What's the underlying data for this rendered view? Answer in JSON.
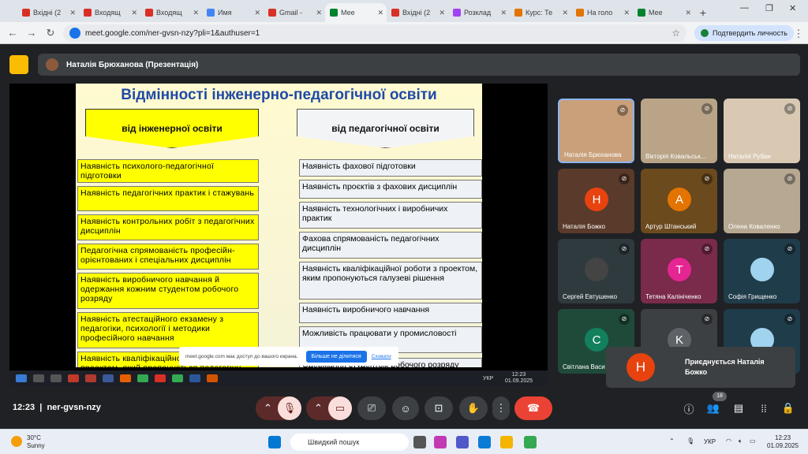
{
  "browser": {
    "tabs": [
      {
        "label": "Вхідні (2",
        "color": "#d93025"
      },
      {
        "label": "Входящ",
        "color": "#d93025"
      },
      {
        "label": "Входящ",
        "color": "#d93025"
      },
      {
        "label": "Имя",
        "color": "#4285f4"
      },
      {
        "label": "Gmail -",
        "color": "#d93025"
      },
      {
        "label": "Мее",
        "color": "#00832d",
        "active": true
      },
      {
        "label": "Вхідні (2",
        "color": "#d93025"
      },
      {
        "label": "Розклад",
        "color": "#a142f4"
      },
      {
        "label": "Курс: Те",
        "color": "#e37400"
      },
      {
        "label": "На голо",
        "color": "#e37400"
      },
      {
        "label": "Мее",
        "color": "#00832d"
      }
    ],
    "url": "meet.google.com/ner-gvsn-nzy?pli=1&authuser=1",
    "verify_label": "Подтвердить личность"
  },
  "meet": {
    "presenter_name": "Наталія Брюханова (Презентація)",
    "time": "12:23",
    "meeting_code": "ner-gvsn-nzy",
    "participants_count": "18"
  },
  "slide": {
    "title": "Відмінності інженерно-педагогічної освіти",
    "left_header": "від інженерної освіти",
    "right_header": "від педагогічної освіти",
    "left_items": [
      "Наявність психолого-педагогічної підготовки",
      "Наявність педагогічних практик і стажувань",
      "Наявність контрольних робіт з педагогічних дисциплін",
      "Педагогічна спрямованість професійн-орієнтованих і спеціальних дисциплін",
      "Наявність виробничого навчання й одержання кожним студентом робочого розряду",
      "Наявність атестаційного екзамену з педагогіки, психології і методики професійного навчання",
      "Наявність кваліфікаційної роботи з проектом, який пропонується педагогічн"
    ],
    "right_items": [
      "Наявність фахової підготовки",
      "Наявність проєктів з фахових дисциплін",
      "Наявність технологічних і виробничих практик",
      "Фахова спрямованість педагогічних дисциплін",
      "Наявність кваліфікаційної роботи з проектом, яким пропонуються галузеві рішення",
      "Наявність виробничого навчання",
      "Можливість працювати у промисловості",
      "Одержання студентом робочого розряду"
    ]
  },
  "share_bar": {
    "text": "meet.google.com має доступ до вашого екрана.",
    "stop_label": "Більше не ділитися",
    "hide_label": "Сховати"
  },
  "remote_taskbar": {
    "time": "12:23",
    "date": "01.09.2025",
    "lang": "УКР"
  },
  "tiles": [
    {
      "name": "Наталія Брюханова",
      "initial": "",
      "bg": "#c9a07a"
    },
    {
      "name": "Вікторія Ковальськ...",
      "initial": "",
      "bg": "#b9a488"
    },
    {
      "name": "Наталія Рубан",
      "initial": "",
      "bg": "#d9c9b3"
    },
    {
      "name": "Наталія Божко",
      "initial": "Н",
      "bg": "#5a3a2a",
      "circle": "#e8430f"
    },
    {
      "name": "Артур Штанський",
      "initial": "А",
      "bg": "#6b4a1e",
      "circle": "#e37400"
    },
    {
      "name": "Олена Коваленко",
      "initial": "",
      "bg": "#b7a892"
    },
    {
      "name": "Сергей Евтушенко",
      "initial": "",
      "bg": "#2f3a3e",
      "circle": "#444"
    },
    {
      "name": "Тетяна Калініченко",
      "initial": "Т",
      "bg": "#7a2a4a",
      "circle": "#e52592"
    },
    {
      "name": "Софія Грищенко",
      "initial": "",
      "bg": "#1f3c4a",
      "circle": "#9fd3ee"
    },
    {
      "name": "Світлана Васи",
      "initial": "С",
      "bg": "#1f4a3a",
      "circle": "#12805c"
    },
    {
      "name": "",
      "initial": "K",
      "bg": "#3c4043",
      "circle": "#5f6368"
    },
    {
      "name": "",
      "initial": "",
      "bg": "#1f3c4a",
      "circle": "#9fd3ee"
    }
  ],
  "toast": {
    "initial": "Н",
    "text": "Приєднується Наталія Божко"
  },
  "os": {
    "temp": "30°C",
    "weather": "Sunny",
    "search_placeholder": "Швидкий пошук",
    "lang": "УКР",
    "time": "12:23",
    "date": "01.09.2025"
  }
}
